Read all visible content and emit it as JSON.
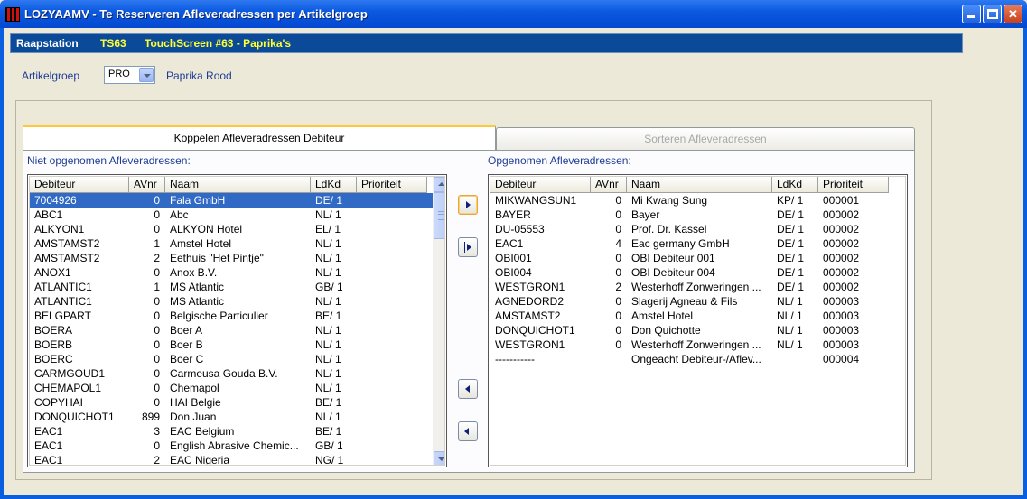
{
  "window": {
    "title": "LOZYAAMV - Te Reserveren Afleveradressen per Artikelgroep"
  },
  "status": {
    "label": "Raapstation",
    "code": "TS63",
    "description": "TouchScreen #63 - Paprika's"
  },
  "artikelgroep": {
    "label": "Artikelgroep",
    "value": "PRO",
    "name": "Paprika Rood"
  },
  "tabs": [
    {
      "label": "Koppelen Afleveradressen Debiteur",
      "active": true
    },
    {
      "label": "Sorteren Afleveradressen",
      "active": false
    }
  ],
  "left_list": {
    "title": "Niet opgenomen Afleveradressen:",
    "columns": [
      "Debiteur",
      "AVnr",
      "Naam",
      "LdKd",
      "Prioriteit"
    ],
    "rows": [
      [
        "7004926",
        "0",
        "Fala GmbH",
        "DE/ 1",
        ""
      ],
      [
        "ABC1",
        "0",
        "Abc",
        "NL/ 1",
        ""
      ],
      [
        "ALKYON1",
        "0",
        "ALKYON Hotel",
        "EL/ 1",
        ""
      ],
      [
        "AMSTAMST2",
        "1",
        "Amstel Hotel",
        "NL/ 1",
        ""
      ],
      [
        "AMSTAMST2",
        "2",
        "Eethuis \"Het Pintje\"",
        "NL/ 1",
        ""
      ],
      [
        "ANOX1",
        "0",
        "Anox B.V.",
        "NL/ 1",
        ""
      ],
      [
        "ATLANTIC1",
        "1",
        "MS Atlantic",
        "GB/ 1",
        ""
      ],
      [
        "ATLANTIC1",
        "0",
        "MS Atlantic",
        "NL/ 1",
        ""
      ],
      [
        "BELGPART",
        "0",
        "Belgische Particulier",
        "BE/ 1",
        ""
      ],
      [
        "BOERA",
        "0",
        "Boer A",
        "NL/ 1",
        ""
      ],
      [
        "BOERB",
        "0",
        "Boer B",
        "NL/ 1",
        ""
      ],
      [
        "BOERC",
        "0",
        "Boer C",
        "NL/ 1",
        ""
      ],
      [
        "CARMGOUD1",
        "0",
        "Carmeusa Gouda B.V.",
        "NL/ 1",
        ""
      ],
      [
        "CHEMAPOL1",
        "0",
        "Chemapol",
        "NL/ 1",
        ""
      ],
      [
        "COPYHAI",
        "0",
        "HAI Belgie",
        "BE/ 1",
        ""
      ],
      [
        "DONQUICHOT1",
        "899",
        "Don Juan",
        "NL/ 1",
        ""
      ],
      [
        "EAC1",
        "3",
        "EAC Belgium",
        "BE/ 1",
        ""
      ],
      [
        "EAC1",
        "0",
        "English Abrasive Chemic...",
        "GB/ 1",
        ""
      ],
      [
        "EAC1",
        "2",
        "EAC Nigeria",
        "NG/ 1",
        ""
      ]
    ]
  },
  "right_list": {
    "title": "Opgenomen Afleveradressen:",
    "columns": [
      "Debiteur",
      "AVnr",
      "Naam",
      "LdKd",
      "Prioriteit"
    ],
    "rows": [
      [
        "MIKWANGSUN1",
        "0",
        "Mi Kwang Sung",
        "KP/ 1",
        "000001"
      ],
      [
        "BAYER",
        "0",
        "Bayer",
        "DE/ 1",
        "000002"
      ],
      [
        "DU-05553",
        "0",
        "Prof. Dr. Kassel",
        "DE/ 1",
        "000002"
      ],
      [
        "EAC1",
        "4",
        "Eac germany GmbH",
        "DE/ 1",
        "000002"
      ],
      [
        "OBI001",
        "0",
        "OBI Debiteur 001",
        "DE/ 1",
        "000002"
      ],
      [
        "OBI004",
        "0",
        "OBI Debiteur 004",
        "DE/ 1",
        "000002"
      ],
      [
        "WESTGRON1",
        "2",
        "Westerhoff Zonweringen ...",
        "DE/ 1",
        "000002"
      ],
      [
        "AGNEDORD2",
        "0",
        "Slagerij Agneau & Fils",
        "NL/ 1",
        "000003"
      ],
      [
        "AMSTAMST2",
        "0",
        "Amstel Hotel",
        "NL/ 1",
        "000003"
      ],
      [
        "DONQUICHOT1",
        "0",
        "Don Quichotte",
        "NL/ 1",
        "000003"
      ],
      [
        "WESTGRON1",
        "0",
        "Westerhoff Zonweringen ...",
        "NL/ 1",
        "000003"
      ],
      [
        "-----------",
        "",
        "Ongeacht Debiteur-/Aflev...",
        "",
        "000004"
      ]
    ]
  },
  "colors": {
    "selection": "#316AC5",
    "status_bar": "#0B4A98",
    "status_highlight": "#FFFF33"
  }
}
